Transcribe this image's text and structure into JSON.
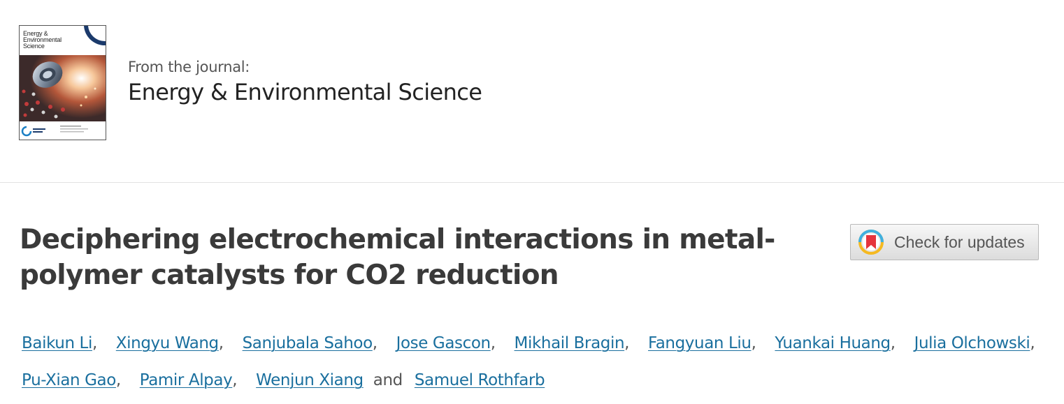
{
  "journal": {
    "intro": "From the journal:",
    "name": "Energy & Environmental Science",
    "cover_title": "Energy & Environmental Science"
  },
  "article": {
    "title_line1": "Deciphering electrochemical interactions in metal-",
    "title_line2": "polymer catalysts for CO2 reduction"
  },
  "check_updates": {
    "label": "Check for updates",
    "icon": "crossmark-icon"
  },
  "authors": {
    "list": [
      "Baikun Li",
      "Xingyu Wang",
      "Sanjubala Sahoo",
      "Jose Gascon",
      "Mikhail Bragin",
      "Fangyuan Liu",
      "Yuankai Huang",
      "Julia Olchowski",
      "Pu-Xian Gao",
      "Pamir Alpay",
      "Wenjun Xiang",
      "Samuel Rothfarb"
    ],
    "separator": ",",
    "conjunction": "and"
  },
  "colors": {
    "link": "#1a6f9e",
    "title": "#3a3a3a",
    "divider": "#e2e2e2"
  }
}
